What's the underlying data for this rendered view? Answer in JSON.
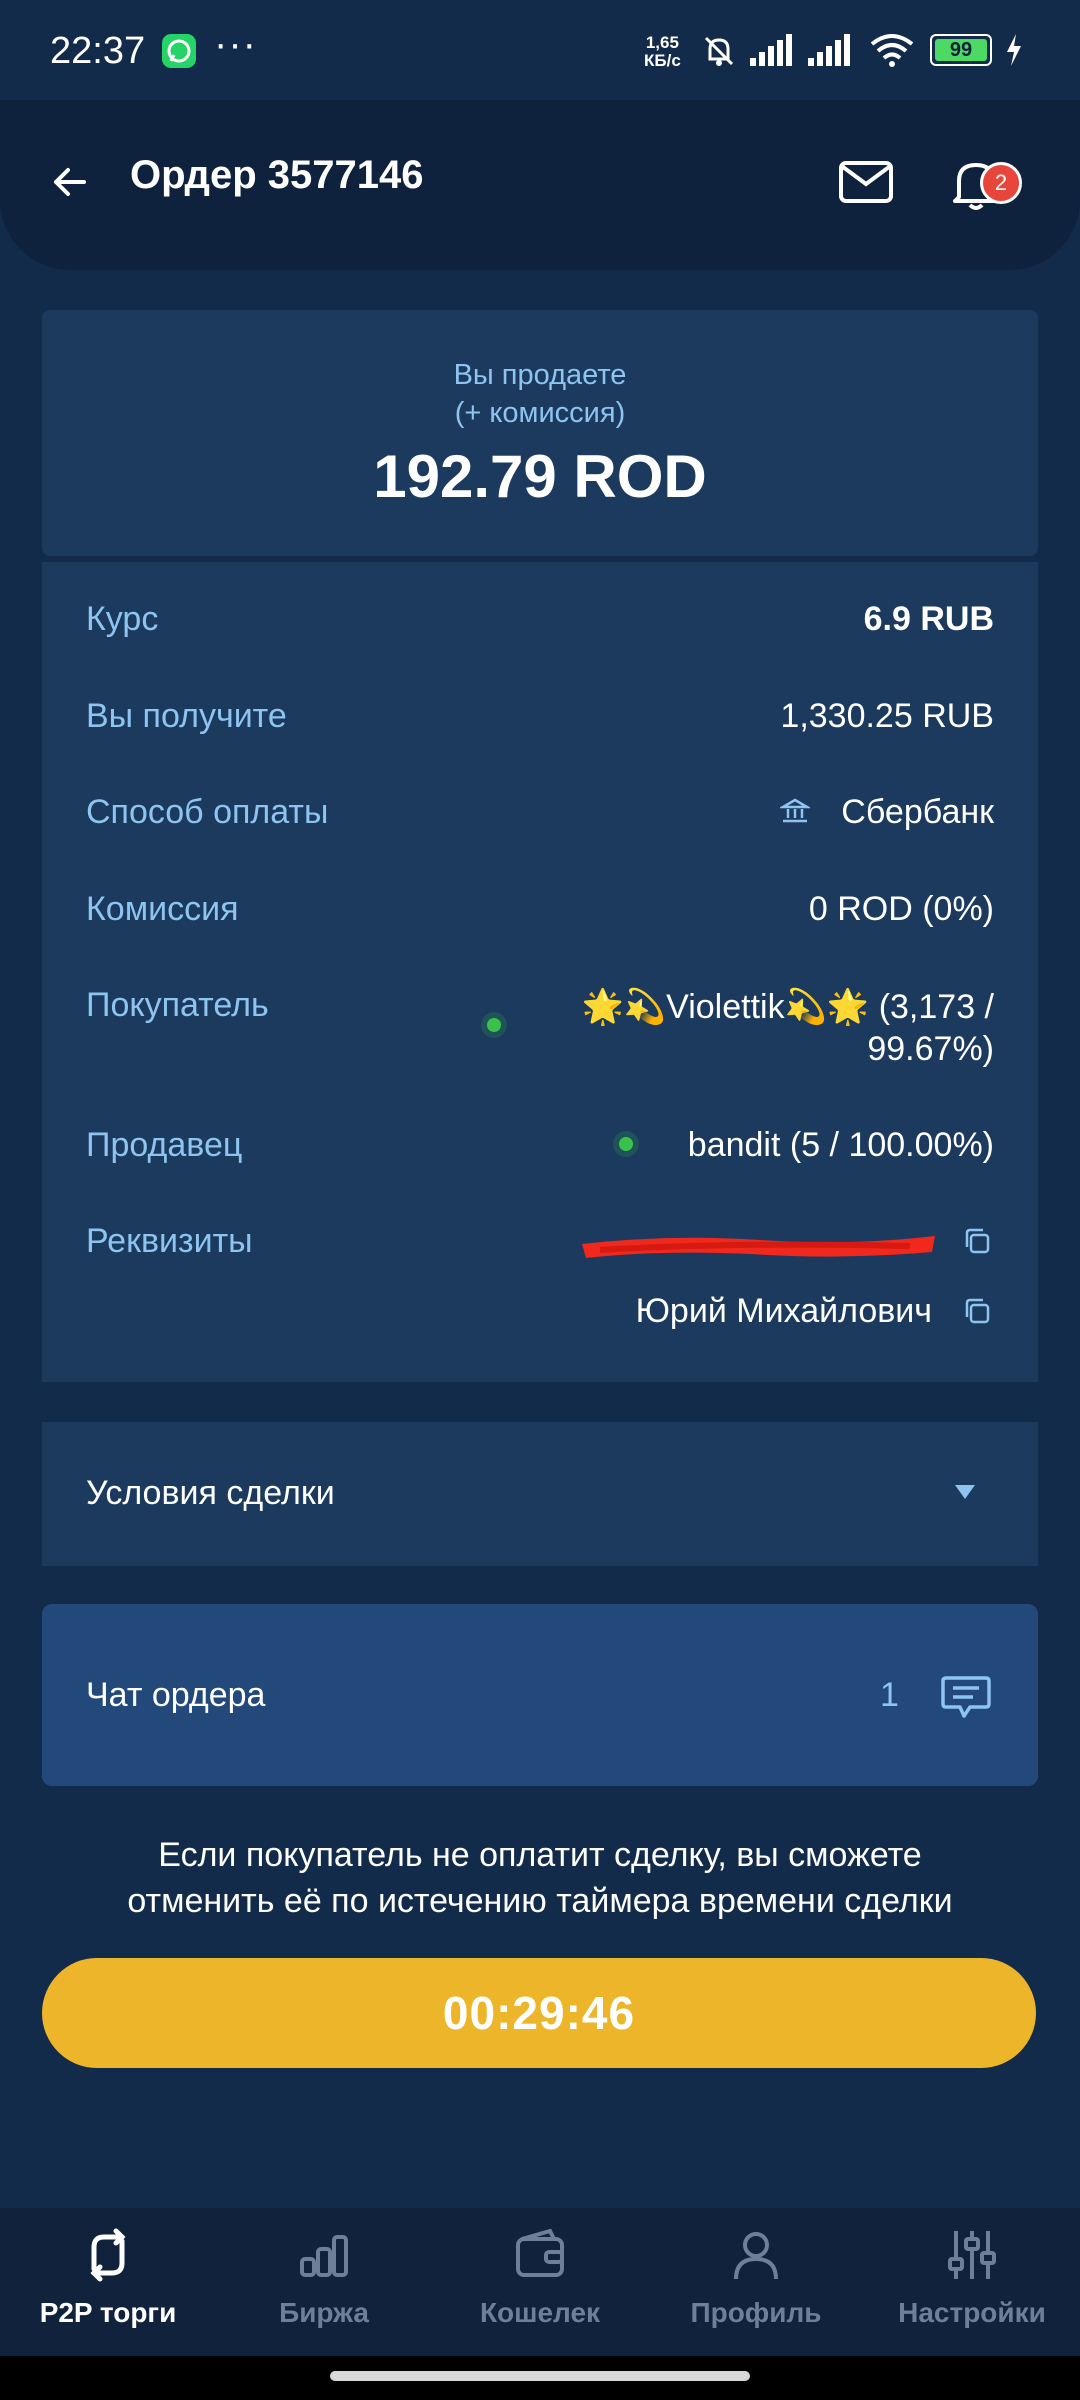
{
  "status_bar": {
    "time": "22:37",
    "net_speed_value": "1,65",
    "net_speed_unit": "КБ/с",
    "battery": "99",
    "icons": [
      "whatsapp-icon",
      "more-icon",
      "mute-bell-icon",
      "signal-icon",
      "signal-icon",
      "wifi-icon",
      "battery-icon",
      "charging-icon"
    ]
  },
  "header": {
    "title": "Ордер 3577146",
    "notification_count": "2",
    "colors": {
      "badge": "#e8453c"
    }
  },
  "sell": {
    "line1": "Вы продаете",
    "line2": "(+ комиссия)",
    "amount": "192.79 ROD"
  },
  "details": {
    "rate_label": "Курс",
    "rate_value": "6.9 RUB",
    "receive_label": "Вы получите",
    "receive_value": "1,330.25 RUB",
    "payment_label": "Способ оплаты",
    "payment_value": "Сбербанк",
    "fee_label": "Комиссия",
    "fee_value": "0 ROD (0%)",
    "buyer_label": "Покупатель",
    "buyer_value_line1": "🌟💫Violettik💫🌟 (3,173 /",
    "buyer_value_line2": "99.67%)",
    "seller_label": "Продавец",
    "seller_value": "bandit (5 / 100.00%)",
    "requisites_label": "Реквизиты",
    "requisites_name": "Юрий Михайлович"
  },
  "conditions": {
    "label": "Условия сделки"
  },
  "chat": {
    "label": "Чат ордера",
    "count": "1"
  },
  "notice": {
    "line1": "Если покупатель не оплатит сделку, вы сможете",
    "line2": "отменить её по истечению таймера времени сделки"
  },
  "timer": {
    "value": "00:29:46",
    "color": "#edb529"
  },
  "nav": {
    "items": [
      {
        "label": "P2P торги",
        "icon": "p2p-exchange-icon",
        "active": true
      },
      {
        "label": "Биржа",
        "icon": "chart-bars-icon",
        "active": false
      },
      {
        "label": "Кошелек",
        "icon": "wallet-icon",
        "active": false
      },
      {
        "label": "Профиль",
        "icon": "user-icon",
        "active": false
      },
      {
        "label": "Настройки",
        "icon": "sliders-icon",
        "active": false
      }
    ]
  }
}
